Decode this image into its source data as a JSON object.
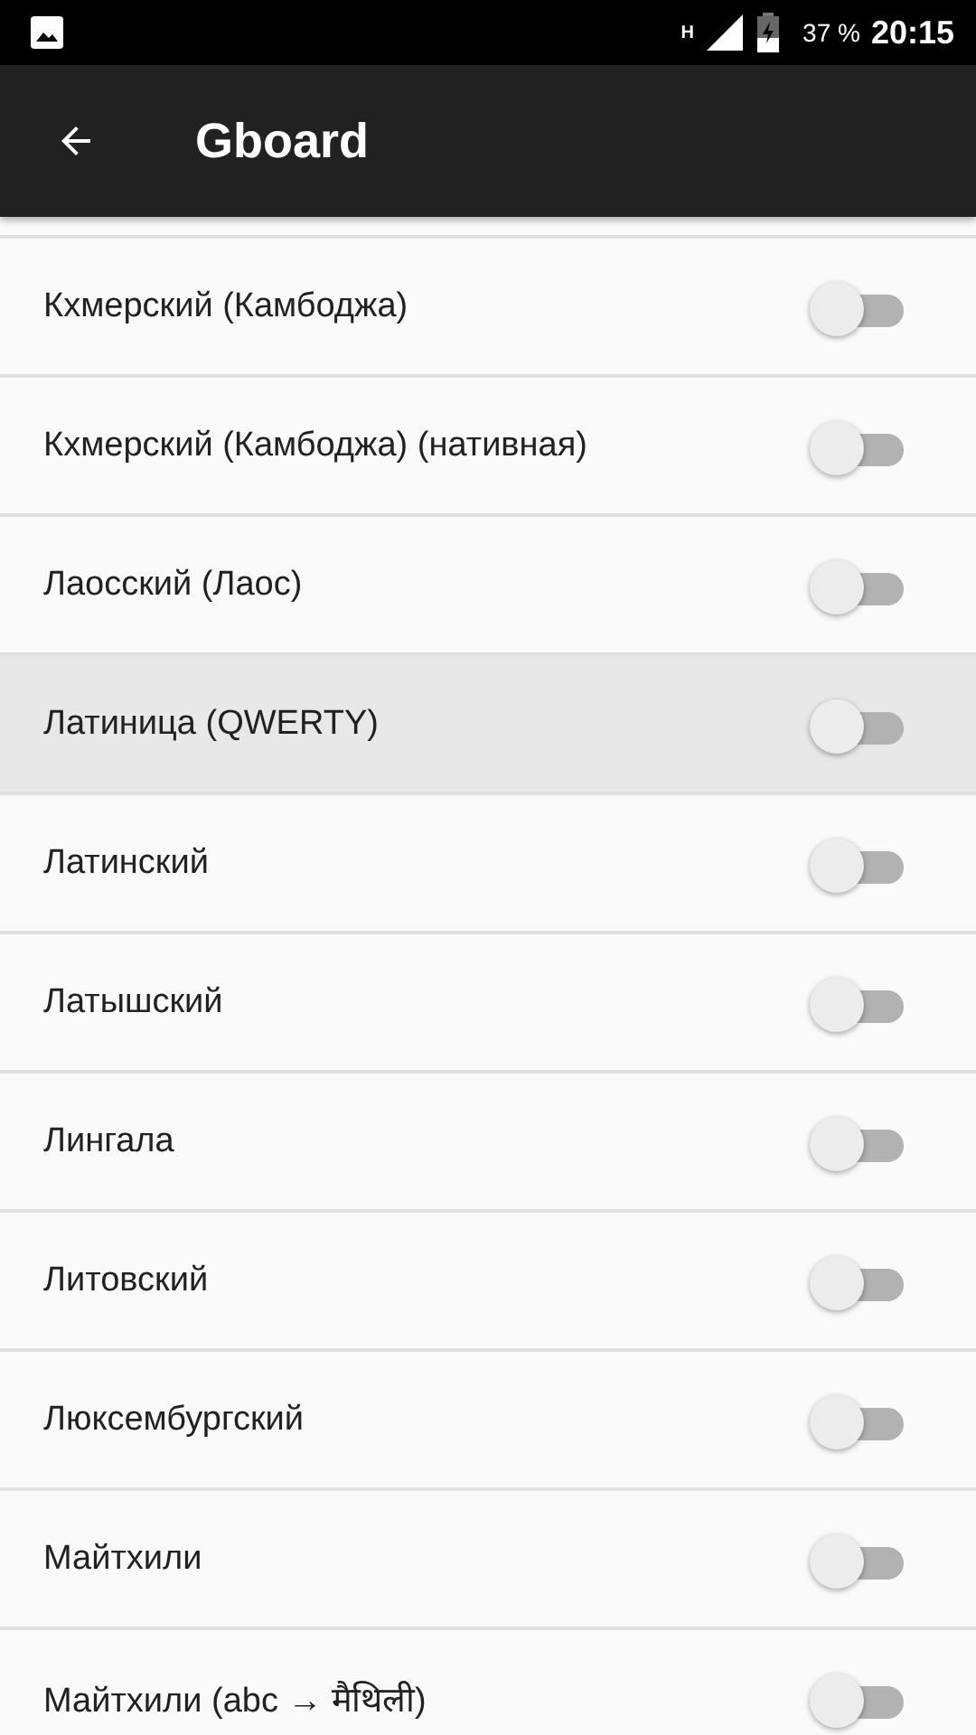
{
  "status_bar": {
    "battery": "37 %",
    "time": "20:15",
    "network": "H"
  },
  "toolbar": {
    "title": "Gboard"
  },
  "languages": [
    {
      "name": "Кхмерский (Камбоджа)",
      "on": false,
      "selected": false
    },
    {
      "name": "Кхмерский (Камбоджа) (нативная)",
      "on": false,
      "selected": false
    },
    {
      "name": "Лаосский (Лаос)",
      "on": false,
      "selected": false
    },
    {
      "name": "Латиница (QWERTY)",
      "on": false,
      "selected": true
    },
    {
      "name": "Латинский",
      "on": false,
      "selected": false
    },
    {
      "name": "Латышский",
      "on": false,
      "selected": false
    },
    {
      "name": "Лингала",
      "on": false,
      "selected": false
    },
    {
      "name": "Литовский",
      "on": false,
      "selected": false
    },
    {
      "name": "Люксембургский",
      "on": false,
      "selected": false
    },
    {
      "name": "Майтхили",
      "on": false,
      "selected": false
    },
    {
      "name": "Майтхили (abc → मैथिली)",
      "on": false,
      "selected": false
    }
  ]
}
